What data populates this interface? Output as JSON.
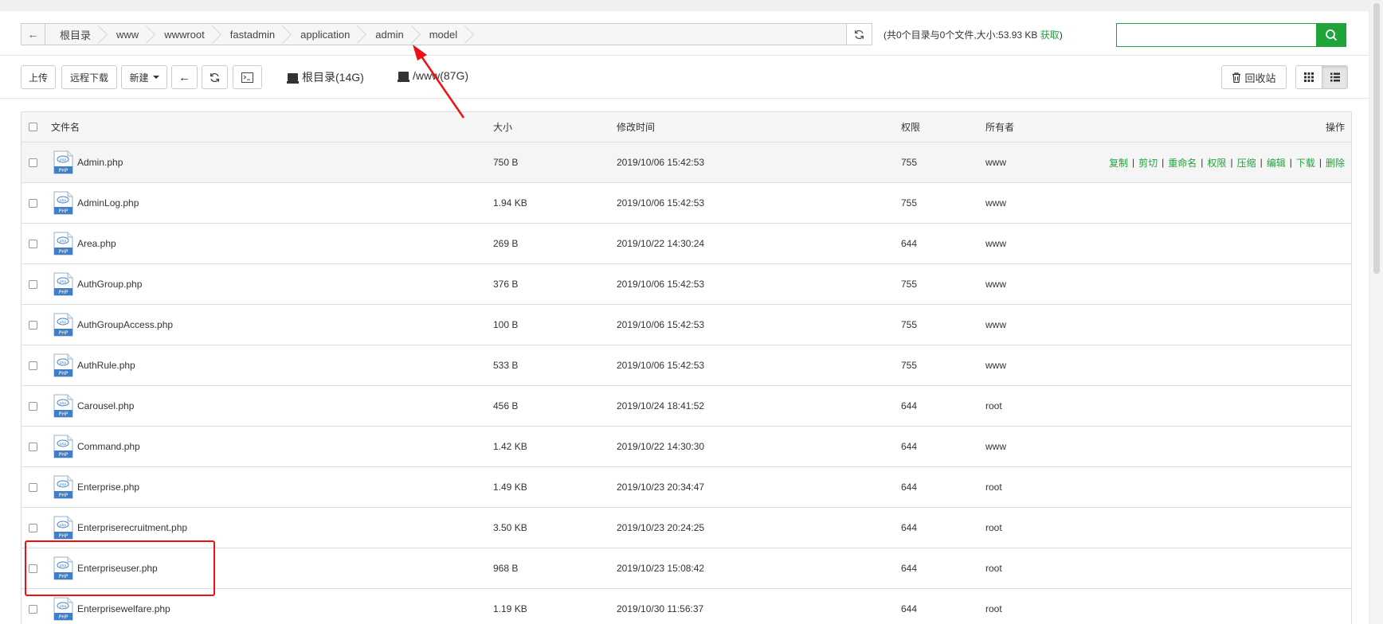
{
  "breadcrumb": {
    "back_icon": "arrow-left-icon",
    "segments": [
      "根目录",
      "www",
      "wwwroot",
      "fastadmin",
      "application",
      "admin",
      "model"
    ],
    "refresh_icon": "refresh-icon"
  },
  "dir_info": {
    "prefix": "(共0个目录与0个文件,大小:",
    "size": "53.93 KB",
    "fetch_label": "获取",
    "suffix": ")"
  },
  "search": {
    "placeholder": "",
    "value": "",
    "button_icon": "search-icon",
    "accent_color": "#20a53a"
  },
  "toolbar": {
    "upload_label": "上传",
    "remote_download_label": "远程下载",
    "new_label": "新建",
    "back_icon": "arrow-left-icon",
    "refresh_icon": "refresh-icon",
    "terminal_icon": "terminal-icon",
    "disks": [
      {
        "icon": "hdd-icon",
        "label": "根目录(14G)"
      },
      {
        "icon": "hdd-icon",
        "label": "/www(87G)"
      }
    ],
    "recycle_label": "回收站",
    "recycle_icon": "trash-icon",
    "grid_view_icon": "grid-view-icon",
    "list_view_icon": "list-view-icon"
  },
  "table": {
    "headers": {
      "name": "文件名",
      "size": "大小",
      "mtime": "修改时间",
      "perm": "权限",
      "owner": "所有者",
      "ops": "操作"
    },
    "ops": [
      "复制",
      "剪切",
      "重命名",
      "权限",
      "压缩",
      "编辑",
      "下载",
      "删除"
    ],
    "rows": [
      {
        "name": "Admin.php",
        "size": "750 B",
        "mtime": "2019/10/06 15:42:53",
        "perm": "755",
        "owner": "www"
      },
      {
        "name": "AdminLog.php",
        "size": "1.94 KB",
        "mtime": "2019/10/06 15:42:53",
        "perm": "755",
        "owner": "www"
      },
      {
        "name": "Area.php",
        "size": "269 B",
        "mtime": "2019/10/22 14:30:24",
        "perm": "644",
        "owner": "www"
      },
      {
        "name": "AuthGroup.php",
        "size": "376 B",
        "mtime": "2019/10/06 15:42:53",
        "perm": "755",
        "owner": "www"
      },
      {
        "name": "AuthGroupAccess.php",
        "size": "100 B",
        "mtime": "2019/10/06 15:42:53",
        "perm": "755",
        "owner": "www"
      },
      {
        "name": "AuthRule.php",
        "size": "533 B",
        "mtime": "2019/10/06 15:42:53",
        "perm": "755",
        "owner": "www"
      },
      {
        "name": "Carousel.php",
        "size": "456 B",
        "mtime": "2019/10/24 18:41:52",
        "perm": "644",
        "owner": "root"
      },
      {
        "name": "Command.php",
        "size": "1.42 KB",
        "mtime": "2019/10/22 14:30:30",
        "perm": "644",
        "owner": "www"
      },
      {
        "name": "Enterprise.php",
        "size": "1.49 KB",
        "mtime": "2019/10/23 20:34:47",
        "perm": "644",
        "owner": "root"
      },
      {
        "name": "Enterpriserecruitment.php",
        "size": "3.50 KB",
        "mtime": "2019/10/23 20:24:25",
        "perm": "644",
        "owner": "root"
      },
      {
        "name": "Enterpriseuser.php",
        "size": "968 B",
        "mtime": "2019/10/23 15:08:42",
        "perm": "644",
        "owner": "root"
      },
      {
        "name": "Enterprisewelfare.php",
        "size": "1.19 KB",
        "mtime": "2019/10/30 11:56:37",
        "perm": "644",
        "owner": "root"
      }
    ],
    "file_icon": "php-file-icon",
    "file_icon_text": "PHP"
  },
  "annotations": {
    "highlight_color": "#ee1111",
    "arrow_color": "#ee1111"
  }
}
